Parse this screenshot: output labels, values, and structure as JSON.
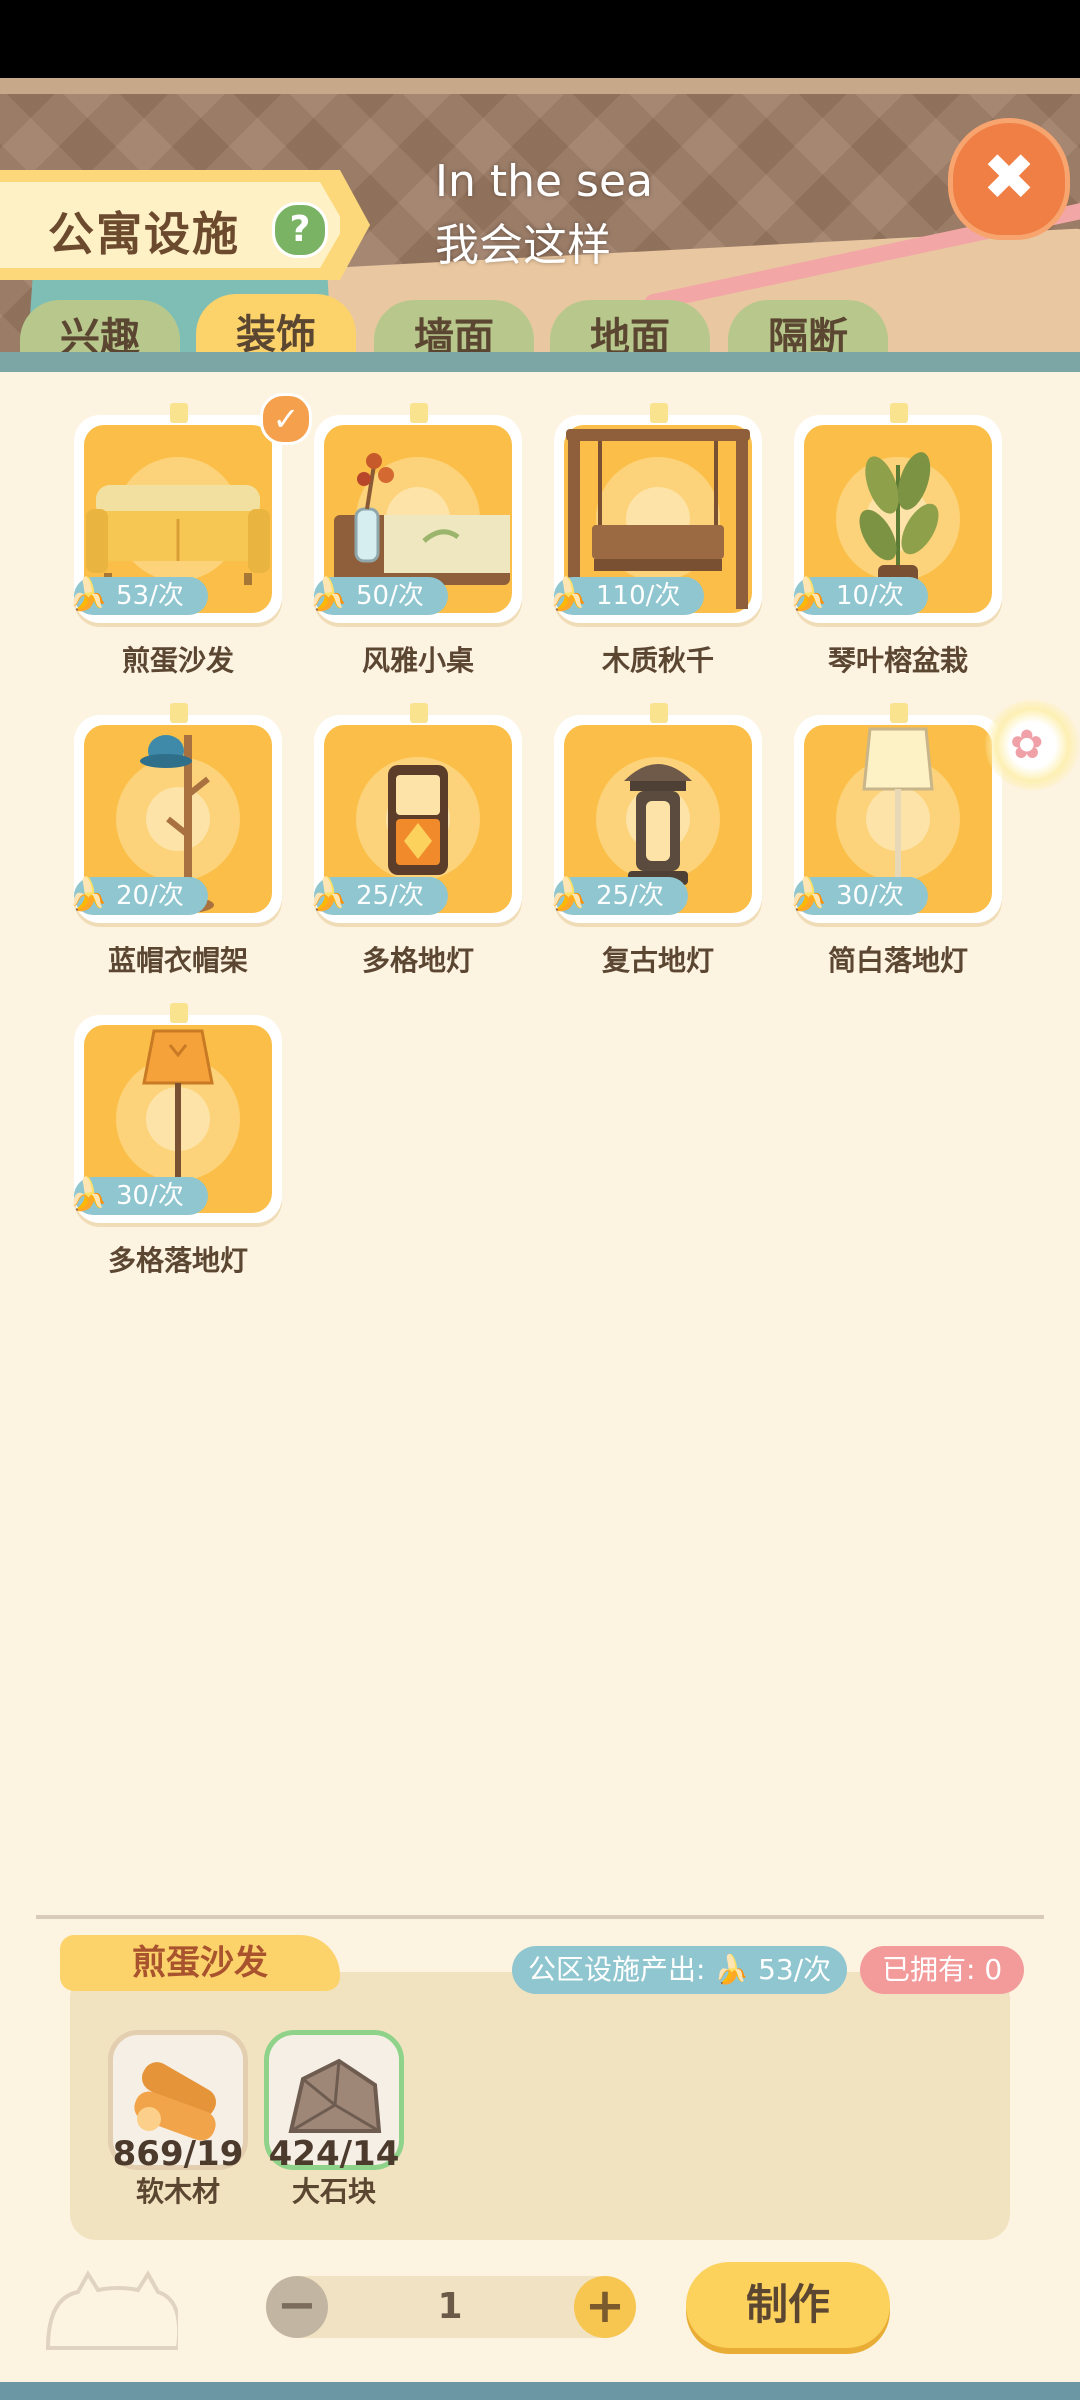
{
  "header": {
    "title": "公寓设施",
    "help_label": "?",
    "song_line1": "In the sea",
    "song_line2": "我会这样",
    "close_label": "✖"
  },
  "tabs": [
    {
      "label": "兴趣",
      "active": false
    },
    {
      "label": "装饰",
      "active": true
    },
    {
      "label": "墙面",
      "active": false
    },
    {
      "label": "地面",
      "active": false
    },
    {
      "label": "隔断",
      "active": false
    }
  ],
  "items": [
    {
      "name": "煎蛋沙发",
      "price": "53/次",
      "selected": true,
      "icon": "sofa-icon"
    },
    {
      "name": "风雅小桌",
      "price": "50/次",
      "selected": false,
      "icon": "table-icon"
    },
    {
      "name": "木质秋千",
      "price": "110/次",
      "selected": false,
      "icon": "swing-icon"
    },
    {
      "name": "琴叶榕盆栽",
      "price": "10/次",
      "selected": false,
      "icon": "plant-icon"
    },
    {
      "name": "蓝帽衣帽架",
      "price": "20/次",
      "selected": false,
      "icon": "coat-rack-icon"
    },
    {
      "name": "多格地灯",
      "price": "25/次",
      "selected": false,
      "icon": "floor-lamp-icon"
    },
    {
      "name": "复古地灯",
      "price": "25/次",
      "selected": false,
      "icon": "lantern-icon"
    },
    {
      "name": "简白落地灯",
      "price": "30/次",
      "selected": false,
      "icon": "white-lamp-icon"
    },
    {
      "name": "多格落地灯",
      "price": "30/次",
      "selected": false,
      "icon": "tall-lamp-icon"
    }
  ],
  "detail": {
    "selected_name": "煎蛋沙发",
    "production": "公区设施产出: 🍌 53/次",
    "owned": "已拥有: 0",
    "materials": [
      {
        "count": "869/19",
        "name": "软木材",
        "icon": "wood-icon"
      },
      {
        "count": "424/14",
        "name": "大石块",
        "icon": "stone-icon"
      }
    ]
  },
  "footer": {
    "minus_label": "−",
    "quantity": "1",
    "plus_label": "+",
    "make_label": "制作"
  },
  "colors": {
    "background": "#fdf3e1",
    "tile": "#fbbf49",
    "price_badge": "#8fc6cf",
    "active_tab": "#fcd26b",
    "owned_badge": "#f39a9b"
  }
}
